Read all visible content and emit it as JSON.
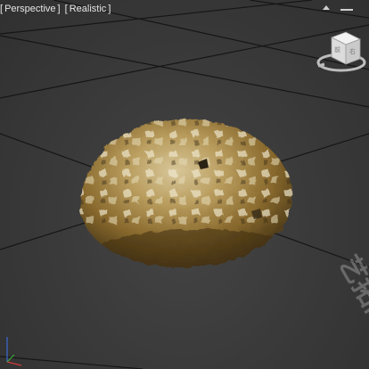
{
  "viewport": {
    "view_name": "Perspective",
    "shading_mode": "Realistic",
    "bracket_open": "[",
    "bracket_close": "]"
  },
  "viewcube": {
    "front_label": "前",
    "right_label": "右"
  },
  "watermark": {
    "text": "艺拓网yt"
  },
  "colors": {
    "background": "#3a3a3a",
    "grid_line": "#1a1a1a",
    "rock_base": "#a88a4a"
  },
  "icons": {
    "viewcube": "viewcube-icon",
    "axis": "axis-tripod-icon"
  }
}
